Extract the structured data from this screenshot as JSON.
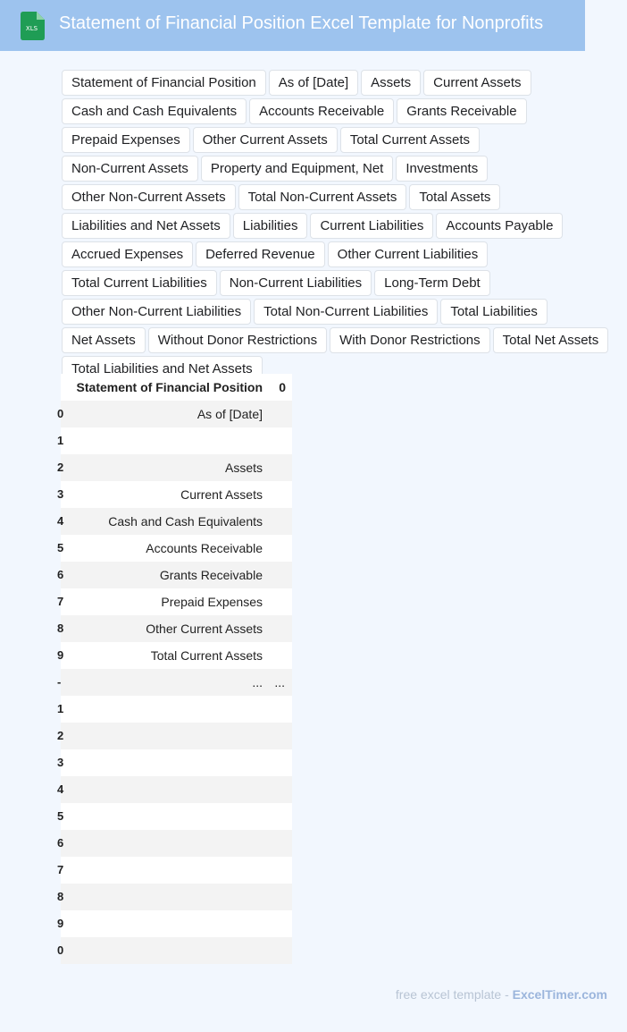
{
  "header": {
    "title": "Statement of Financial Position Excel Template for Nonprofits",
    "icon_label": "XLS",
    "background": "#9dc3ee",
    "icon_color": "#1f9d55"
  },
  "tags": [
    "Statement of Financial Position",
    "As of [Date]",
    "Assets",
    "Current Assets",
    "Cash and Cash Equivalents",
    "Accounts Receivable",
    "Grants Receivable",
    "Prepaid Expenses",
    "Other Current Assets",
    "Total Current Assets",
    "Non-Current Assets",
    "Property and Equipment, Net",
    "Investments",
    "Other Non-Current Assets",
    "Total Non-Current Assets",
    "Total Assets",
    "Liabilities and Net Assets",
    "Liabilities",
    "Current Liabilities",
    "Accounts Payable",
    "Accrued Expenses",
    "Deferred Revenue",
    "Other Current Liabilities",
    "Total Current Liabilities",
    "Non-Current Liabilities",
    "Long-Term Debt",
    "Other Non-Current Liabilities",
    "Total Non-Current Liabilities",
    "Total Liabilities",
    "Net Assets",
    "Without Donor Restrictions",
    "With Donor Restrictions",
    "Total Net Assets",
    "Total Liabilities and Net Assets"
  ],
  "sheet": {
    "header": {
      "label": "Statement of Financial Position",
      "value": "0"
    },
    "rows": [
      {
        "idx": "0",
        "label": "As of [Date]",
        "value": ""
      },
      {
        "idx": "1",
        "label": "",
        "value": ""
      },
      {
        "idx": "2",
        "label": "Assets",
        "value": ""
      },
      {
        "idx": "3",
        "label": "Current Assets",
        "value": ""
      },
      {
        "idx": "4",
        "label": "Cash and Cash Equivalents",
        "value": ""
      },
      {
        "idx": "5",
        "label": "Accounts Receivable",
        "value": ""
      },
      {
        "idx": "6",
        "label": "Grants Receivable",
        "value": ""
      },
      {
        "idx": "7",
        "label": "Prepaid Expenses",
        "value": ""
      },
      {
        "idx": "8",
        "label": "Other Current Assets",
        "value": ""
      },
      {
        "idx": "9",
        "label": "Total Current Assets",
        "value": ""
      },
      {
        "idx": "-",
        "label": "...",
        "value": "..."
      },
      {
        "idx": "1",
        "label": "",
        "value": ""
      },
      {
        "idx": "2",
        "label": "",
        "value": ""
      },
      {
        "idx": "3",
        "label": "",
        "value": ""
      },
      {
        "idx": "4",
        "label": "",
        "value": ""
      },
      {
        "idx": "5",
        "label": "",
        "value": ""
      },
      {
        "idx": "6",
        "label": "",
        "value": ""
      },
      {
        "idx": "7",
        "label": "",
        "value": ""
      },
      {
        "idx": "8",
        "label": "",
        "value": ""
      },
      {
        "idx": "9",
        "label": "",
        "value": ""
      },
      {
        "idx": "0",
        "label": "",
        "value": ""
      }
    ]
  },
  "footer": {
    "prefix": "free excel template - ",
    "brand": "ExcelTimer.com"
  }
}
